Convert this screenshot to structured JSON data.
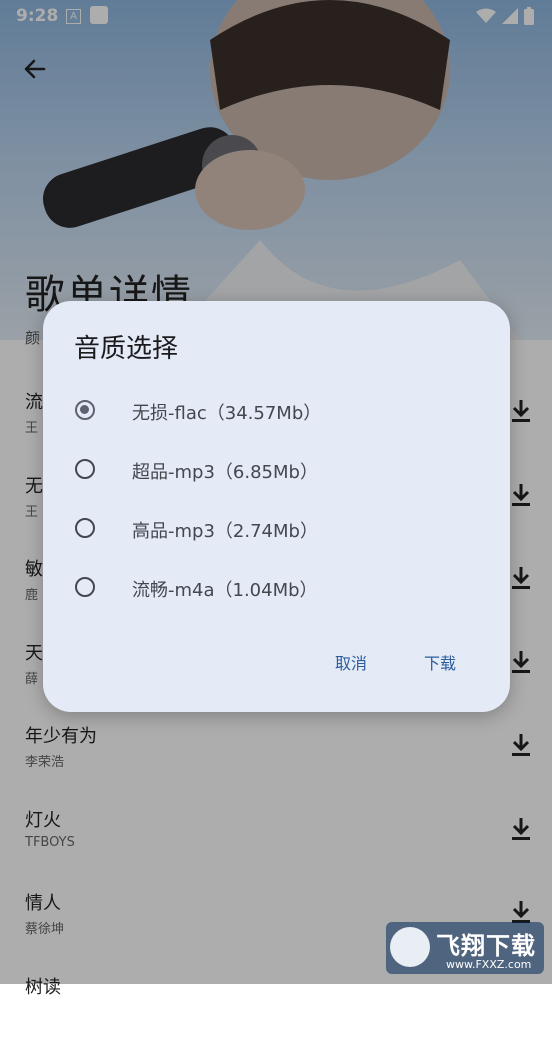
{
  "status_bar": {
    "time": "9:28",
    "a_badge": "A"
  },
  "page": {
    "title": "歌单详情",
    "subtitle": "颜"
  },
  "songs": [
    {
      "title": "流",
      "artist": "王"
    },
    {
      "title": "无",
      "artist": "王"
    },
    {
      "title": "敏",
      "artist": "鹿"
    },
    {
      "title": "天",
      "artist": "薛"
    },
    {
      "title": "年少有为",
      "artist": "李荣浩"
    },
    {
      "title": "灯火",
      "artist": "TFBOYS"
    },
    {
      "title": "情人",
      "artist": "蔡徐坤"
    },
    {
      "title": "树读",
      "artist": ""
    }
  ],
  "dialog": {
    "title": "音质选择",
    "options": [
      {
        "label": "无损-flac（34.57Mb）",
        "selected": true
      },
      {
        "label": "超品-mp3（6.85Mb）",
        "selected": false
      },
      {
        "label": "高品-mp3（2.74Mb）",
        "selected": false
      },
      {
        "label": "流畅-m4a（1.04Mb）",
        "selected": false
      }
    ],
    "cancel_label": "取消",
    "download_label": "下载"
  },
  "watermark": {
    "text": "飞翔下载",
    "url": "www.FXXZ.com"
  },
  "icons": {
    "back": "arrow-left-icon",
    "download": "download-icon",
    "wifi": "wifi-icon",
    "signal": "signal-icon",
    "battery": "battery-icon"
  },
  "colors": {
    "dialog_bg": "#e4eaf6",
    "accent_text": "#2c5d9e",
    "radio": "#5e6270",
    "scrim": "rgba(0,0,0,0.32)"
  }
}
